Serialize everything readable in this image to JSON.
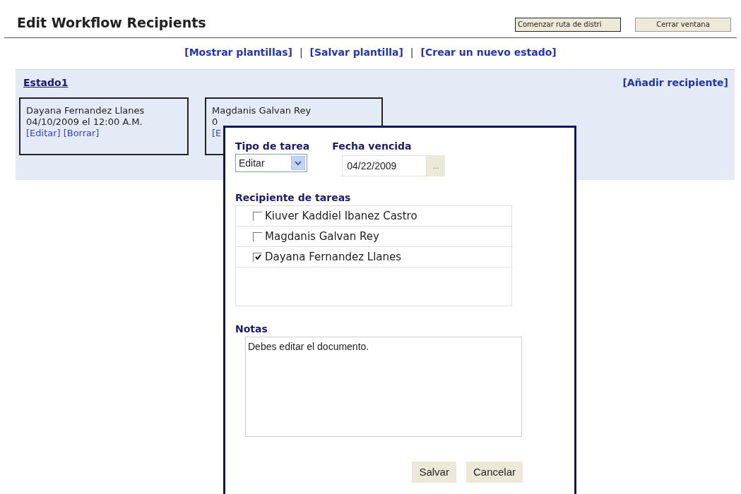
{
  "title": "Edit Workflow Recipients",
  "header_buttons": [
    "Comenzar ruta de distri",
    "Cerrar ventana"
  ],
  "links": [
    "[Mostrar plantillas]",
    "[Salvar plantilla]",
    "[Crear un nuevo estado]"
  ],
  "link_separator": "|",
  "state": {
    "name": "Estado1",
    "add_link": "[Añadir recipiente]",
    "cards": [
      {
        "name": "Dayana Fernandez Llanes",
        "date": "04/10/2009 el 12:00 A.M.",
        "links": [
          "[Editar]",
          "[Borrar]"
        ]
      },
      {
        "name": "Magdanis Galvan Rey",
        "date": "0",
        "links": [
          "[E"
        ]
      }
    ]
  },
  "dialog": {
    "task_type_label": "Tipo de tarea",
    "task_type": "Editar",
    "due_label": "Fecha vencida",
    "due_date": "04/22/2009",
    "date_button": "...",
    "recipients_label": "Recipiente de tareas",
    "recipients": [
      {
        "name": "Kiuver Kaddiel Ibanez Castro",
        "checked": false
      },
      {
        "name": "Magdanis Galvan Rey",
        "checked": false
      },
      {
        "name": "Dayana Fernandez Llanes",
        "checked": true
      }
    ],
    "notes_label": "Notas",
    "notes": "Debes editar el documento.",
    "buttons": [
      "Salvar",
      "Cancelar"
    ]
  }
}
